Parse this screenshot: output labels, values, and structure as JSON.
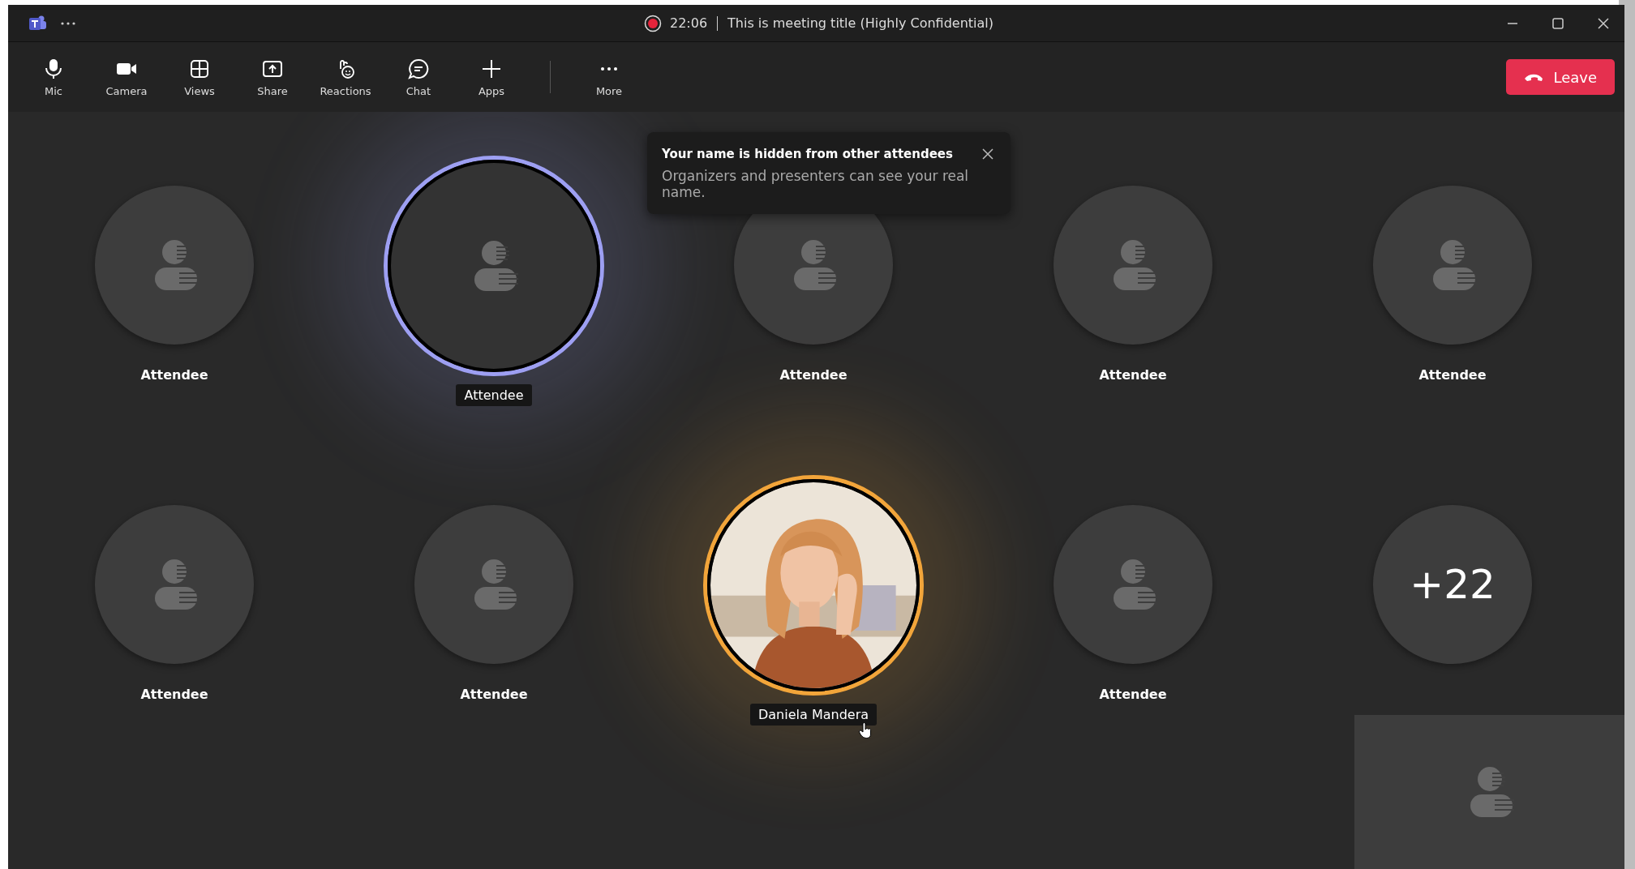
{
  "window": {
    "recording": true,
    "timer": "22:06",
    "title": "This is meeting title (Highly Confidential)"
  },
  "toolbar": {
    "items": [
      {
        "kind": "mic",
        "label": "Mic"
      },
      {
        "kind": "camera",
        "label": "Camera"
      },
      {
        "kind": "views",
        "label": "Views"
      },
      {
        "kind": "share",
        "label": "Share"
      },
      {
        "kind": "reactions",
        "label": "Reactions"
      },
      {
        "kind": "chat",
        "label": "Chat"
      },
      {
        "kind": "apps",
        "label": "Apps"
      }
    ],
    "more": {
      "label": "More"
    }
  },
  "leave_button": {
    "label": "Leave"
  },
  "notice": {
    "title": "Your name is hidden from other attendees",
    "body": "Organizers and presenters can see your real name."
  },
  "tiles": [
    {
      "kind": "attendee",
      "name": "Attendee",
      "speaking": false,
      "hovered": false
    },
    {
      "kind": "attendee",
      "name": "Attendee",
      "speaking": true,
      "color": "#9d9ff2",
      "hovered": false
    },
    {
      "kind": "attendee",
      "name": "Attendee",
      "speaking": false,
      "hovered": false
    },
    {
      "kind": "attendee",
      "name": "Attendee",
      "speaking": false,
      "hovered": false
    },
    {
      "kind": "attendee",
      "name": "Attendee",
      "speaking": false,
      "hovered": false
    },
    {
      "kind": "attendee",
      "name": "Attendee",
      "speaking": false,
      "hovered": false
    },
    {
      "kind": "attendee",
      "name": "Attendee",
      "speaking": false,
      "hovered": false
    },
    {
      "name": "Daniela Mandera",
      "speaking": true,
      "color": "#f2a53a",
      "hovered": true
    },
    {
      "kind": "attendee",
      "name": "Attendee",
      "speaking": false,
      "hovered": false
    },
    {
      "kind": "overflow",
      "count": "+22"
    }
  ],
  "self_view": {
    "kind": "attendee"
  }
}
